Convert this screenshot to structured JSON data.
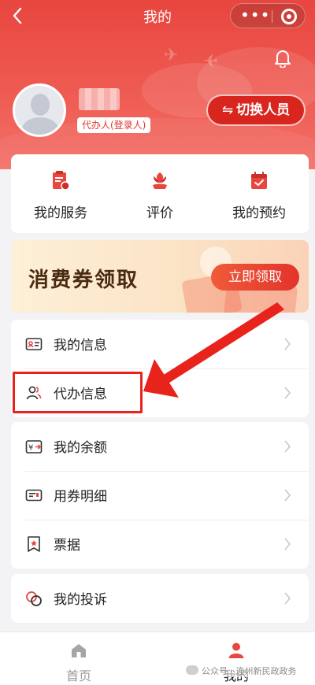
{
  "navbar": {
    "title": "我的"
  },
  "profile": {
    "role_badge": "代办人(登录人)",
    "switch_label": "切换人员"
  },
  "services": [
    {
      "label": "我的服务",
      "icon": "service-doc-icon"
    },
    {
      "label": "评价",
      "icon": "flower-rating-icon"
    },
    {
      "label": "我的预约",
      "icon": "calendar-check-icon"
    }
  ],
  "coupon": {
    "title": "消费券领取",
    "button": "立即领取"
  },
  "menu_group1": [
    {
      "label": "我的信息",
      "icon": "id-card-icon"
    },
    {
      "label": "代办信息",
      "icon": "people-icon"
    }
  ],
  "menu_group2": [
    {
      "label": "我的余额",
      "icon": "wallet-icon"
    },
    {
      "label": "用券明细",
      "icon": "ticket-icon"
    },
    {
      "label": "票据",
      "icon": "receipt-icon"
    }
  ],
  "menu_group3": [
    {
      "label": "我的投诉",
      "icon": "complaint-icon"
    }
  ],
  "tabbar": {
    "home": "首页",
    "mine": "我的"
  },
  "watermark": "公众号 · 连州新民政政务",
  "colors": {
    "primary": "#e8463f",
    "accent": "#e2342b",
    "annotation": "#e8231c"
  }
}
